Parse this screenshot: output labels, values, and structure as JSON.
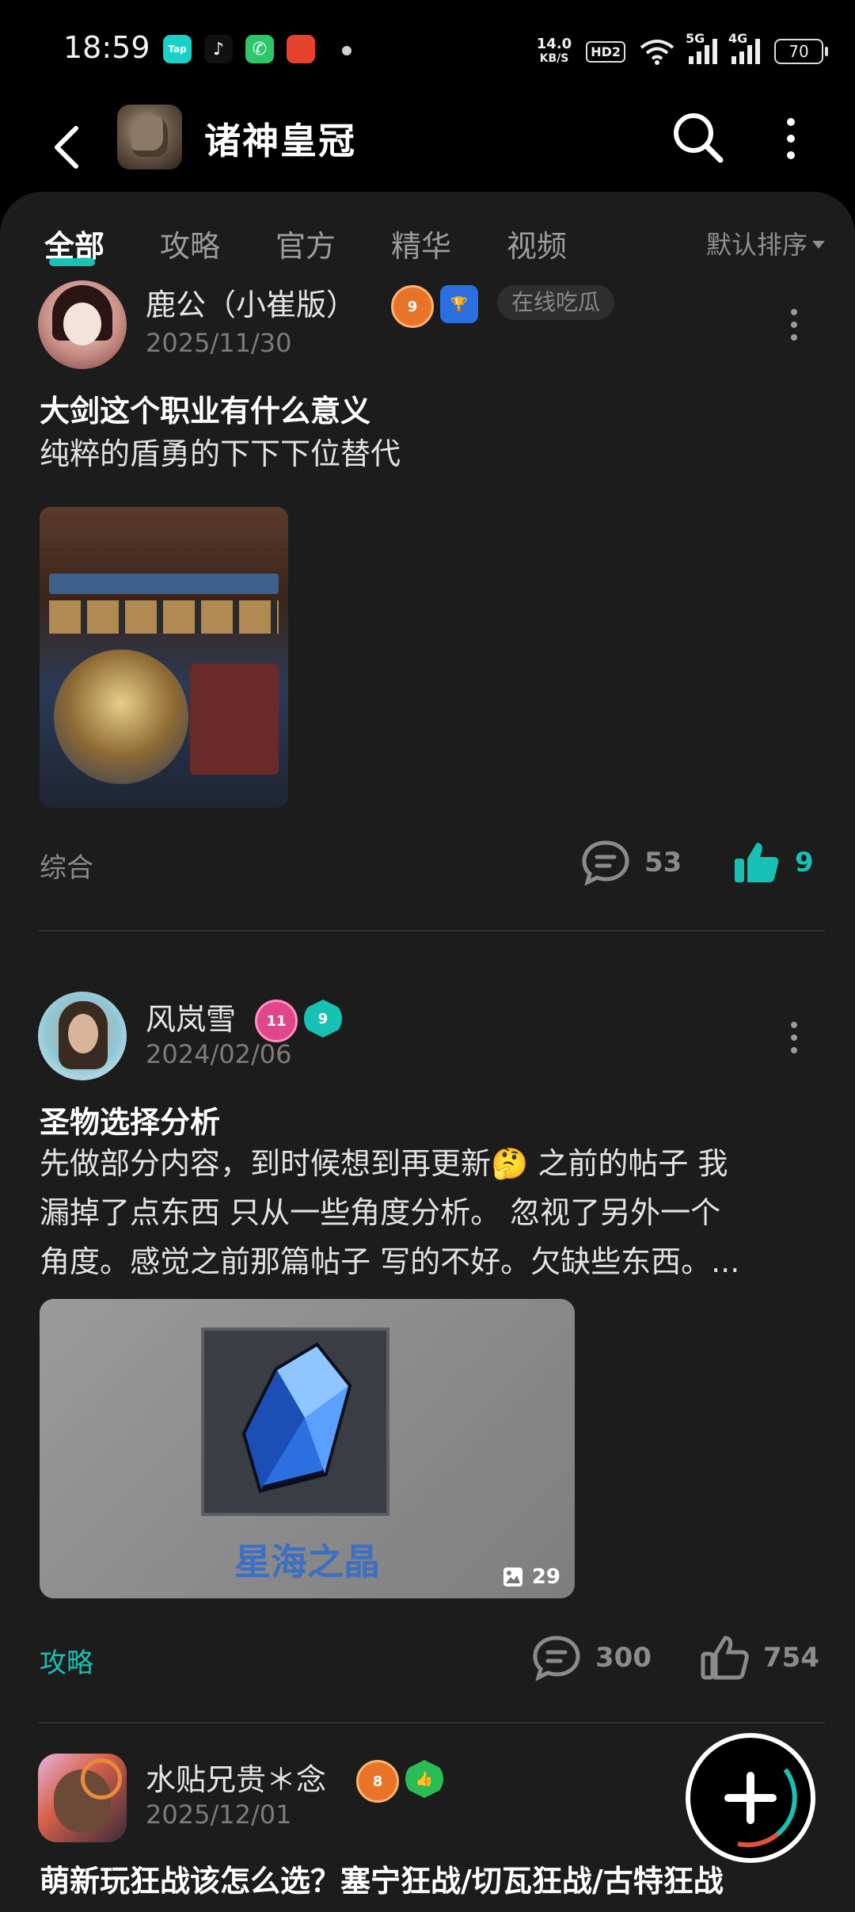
{
  "status_bar": {
    "time": "18:59",
    "net_speed_value": "14.0",
    "net_speed_unit": "KB/S",
    "hd_label": "HD2",
    "net1": "5G",
    "net2": "4G",
    "battery": "70"
  },
  "header": {
    "title": "诸神皇冠"
  },
  "tabs": [
    {
      "label": "全部",
      "active": true
    },
    {
      "label": "攻略",
      "active": false
    },
    {
      "label": "官方",
      "active": false
    },
    {
      "label": "精华",
      "active": false
    },
    {
      "label": "视频",
      "active": false
    }
  ],
  "sort_label": "默认排序",
  "posts": [
    {
      "author": "鹿公（小崔版）",
      "level_badge": "9",
      "tag": "在线吃瓜",
      "date": "2025/11/30",
      "title": "大剑这个职业有什么意义",
      "excerpt": "纯粹的盾勇的下下下位替代",
      "category": "综合",
      "comments": "53",
      "likes": "9",
      "liked": true
    },
    {
      "author": "风岚雪",
      "level_badge": "11",
      "badge2": "9",
      "date": "2024/02/06",
      "title": "圣物选择分析",
      "excerpt_lines": [
        "先做部分内容，到时候想到再更新🤔 之前的帖子 我",
        "漏掉了点东西 只从一些角度分析。 忽视了另外一个",
        "角度。感觉之前那篇帖子 写的不好。欠缺些东西。..."
      ],
      "image_caption": "星海之晶",
      "image_count": "29",
      "category": "攻略",
      "comments": "300",
      "likes": "754",
      "liked": false
    },
    {
      "author": "水贴兄贵＊念",
      "level_badge": "8",
      "date": "2025/12/01",
      "title": "萌新玩狂战该怎么选？塞宁狂战/切瓦狂战/古特狂战"
    }
  ],
  "colors": {
    "accent": "#17c1b3",
    "background": "#1c1c1c",
    "header": "#000000"
  }
}
